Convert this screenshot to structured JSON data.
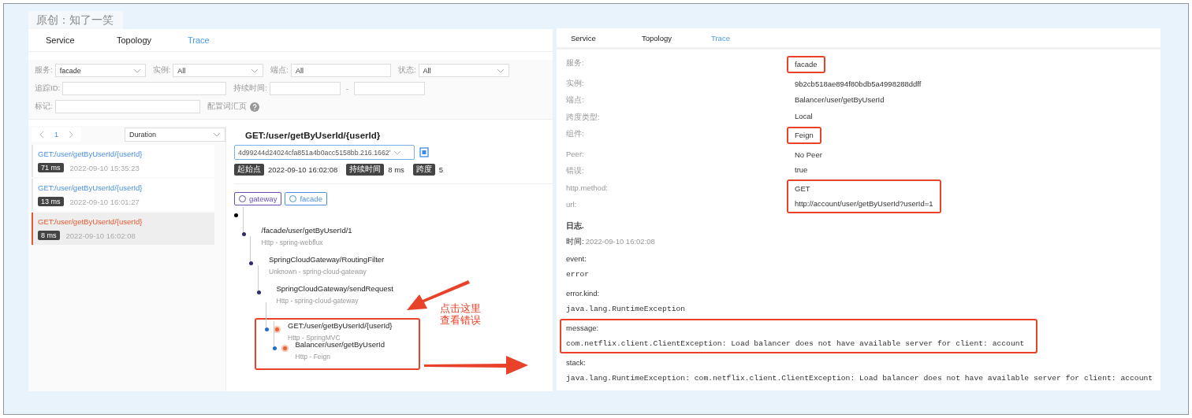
{
  "author_tag": "原创：知了一笑",
  "left": {
    "tabs": [
      {
        "label": "Service",
        "selected": false
      },
      {
        "label": "Topology",
        "selected": false
      },
      {
        "label": "Trace",
        "selected": true
      }
    ],
    "filters": [
      [
        {
          "kind": "select",
          "label": "服务:",
          "value": "facade"
        },
        {
          "kind": "select",
          "label": "实例:",
          "value": "All"
        },
        {
          "kind": "input",
          "label": "端点:",
          "value": "All"
        },
        {
          "kind": "select",
          "label": "状态:",
          "value": "All"
        }
      ],
      [
        {
          "kind": "input",
          "label": "追踪ID:"
        },
        {
          "kind": "range",
          "label": "持续时间:",
          "separator": "-"
        }
      ],
      [
        {
          "kind": "input",
          "label": "标记:"
        },
        {
          "kind": "help",
          "label": "配置词汇页"
        }
      ]
    ],
    "page": "1",
    "sort": "Duration",
    "traces": [
      {
        "endpoint": "GET:/user/getByUserId/{userId}",
        "duration": "71 ms",
        "time": "2022-09-10 15:35:23",
        "selected": false
      },
      {
        "endpoint": "GET:/user/getByUserId/{userId}",
        "duration": "13 ms",
        "time": "2022-09-10 16:01:27",
        "selected": false
      },
      {
        "endpoint": "GET:/user/getByUserId/{userId}",
        "duration": "8 ms",
        "time": "2022-09-10 16:02:08",
        "selected": true
      }
    ],
    "detail": {
      "title": "GET:/user/getByUserId/{userId}",
      "trace_id": "4d99244d24024cfa851a4b0acc5158bb.216.1662'",
      "meta": [
        {
          "tag": "起始点",
          "value": "2022-09-10 16:02:08"
        },
        {
          "tag": "持续时间",
          "value": "8 ms"
        },
        {
          "tag": "跨度",
          "value": "5"
        }
      ],
      "services": [
        {
          "name": "gateway",
          "color": "#6a4fb3"
        },
        {
          "name": "facade",
          "color": "#4a90e2"
        }
      ],
      "spans": [
        {
          "color": "#000000",
          "highlighted": false,
          "error": false,
          "children": [
            {
              "title": "/facade/user/getByUserId/1",
              "subtitle": "Http - spring-webflux",
              "color": "#2d2a6e",
              "highlighted": false,
              "error": false,
              "children": [
                {
                  "title": "SpringCloudGateway/RoutingFilter",
                  "subtitle": "Unknown - spring-cloud-gateway",
                  "color": "#2d2a6e",
                  "highlighted": false,
                  "error": false,
                  "children": [
                    {
                      "title": "SpringCloudGateway/sendRequest",
                      "subtitle": "Http - spring-cloud-gateway",
                      "color": "#2d2a6e",
                      "highlighted": false,
                      "error": false,
                      "children": [
                        {
                          "title": "GET:/user/getByUserId/{userId}",
                          "subtitle": "Http - SpringMVC",
                          "color": "#1e6fc8",
                          "highlighted": true,
                          "error": true,
                          "children": [
                            {
                              "title": "Balancer/user/getByUserId",
                              "subtitle": "Http - Feign",
                              "color": "#1e6fc8",
                              "highlighted": true,
                              "error": true
                            }
                          ]
                        }
                      ]
                    }
                  ]
                }
              ]
            }
          ]
        }
      ]
    }
  },
  "note": "点击这里查看错误",
  "right": {
    "tabs": [
      {
        "label": "Service",
        "selected": false
      },
      {
        "label": "Topology",
        "selected": false
      },
      {
        "label": "Trace",
        "selected": true
      }
    ],
    "attributes": [
      {
        "key": "服务:",
        "value": "facade",
        "highlighted": true
      },
      {
        "key": "实例:",
        "value": "9b2cb518ae894f80bdb5a4998288ddff",
        "highlighted": false
      },
      {
        "key": "端点:",
        "value": "Balancer/user/getByUserId",
        "highlighted": false
      },
      {
        "key": "跨度类型:",
        "value": "Local",
        "highlighted": false
      },
      {
        "key": "组件:",
        "value": "Feign",
        "highlighted": true
      },
      {
        "key": "Peer:",
        "value": "No Peer",
        "highlighted": false
      },
      {
        "key": "错误:",
        "value": "true",
        "highlighted": false
      },
      {
        "key": "http.method:",
        "value": "GET",
        "highlighted": true
      },
      {
        "key": "url:",
        "value": "http://account/user/getByUserId?userId=1",
        "highlighted": true
      }
    ],
    "log_heading": "日志.",
    "time_label": "时间:",
    "time": "2022-09-10 16:02:08",
    "logs": [
      {
        "key": "event:",
        "value": "error",
        "highlighted": false
      },
      {
        "key": "error.kind:",
        "value": "java.lang.RuntimeException",
        "highlighted": false
      },
      {
        "key": "message:",
        "value": "com.netflix.client.ClientException: Load balancer does not have available server for client: account",
        "highlighted": true
      },
      {
        "key": "stack:",
        "value": "java.lang.RuntimeException: com.netflix.client.ClientException: Load balancer does not have available server for client: account",
        "highlighted": false
      }
    ]
  }
}
